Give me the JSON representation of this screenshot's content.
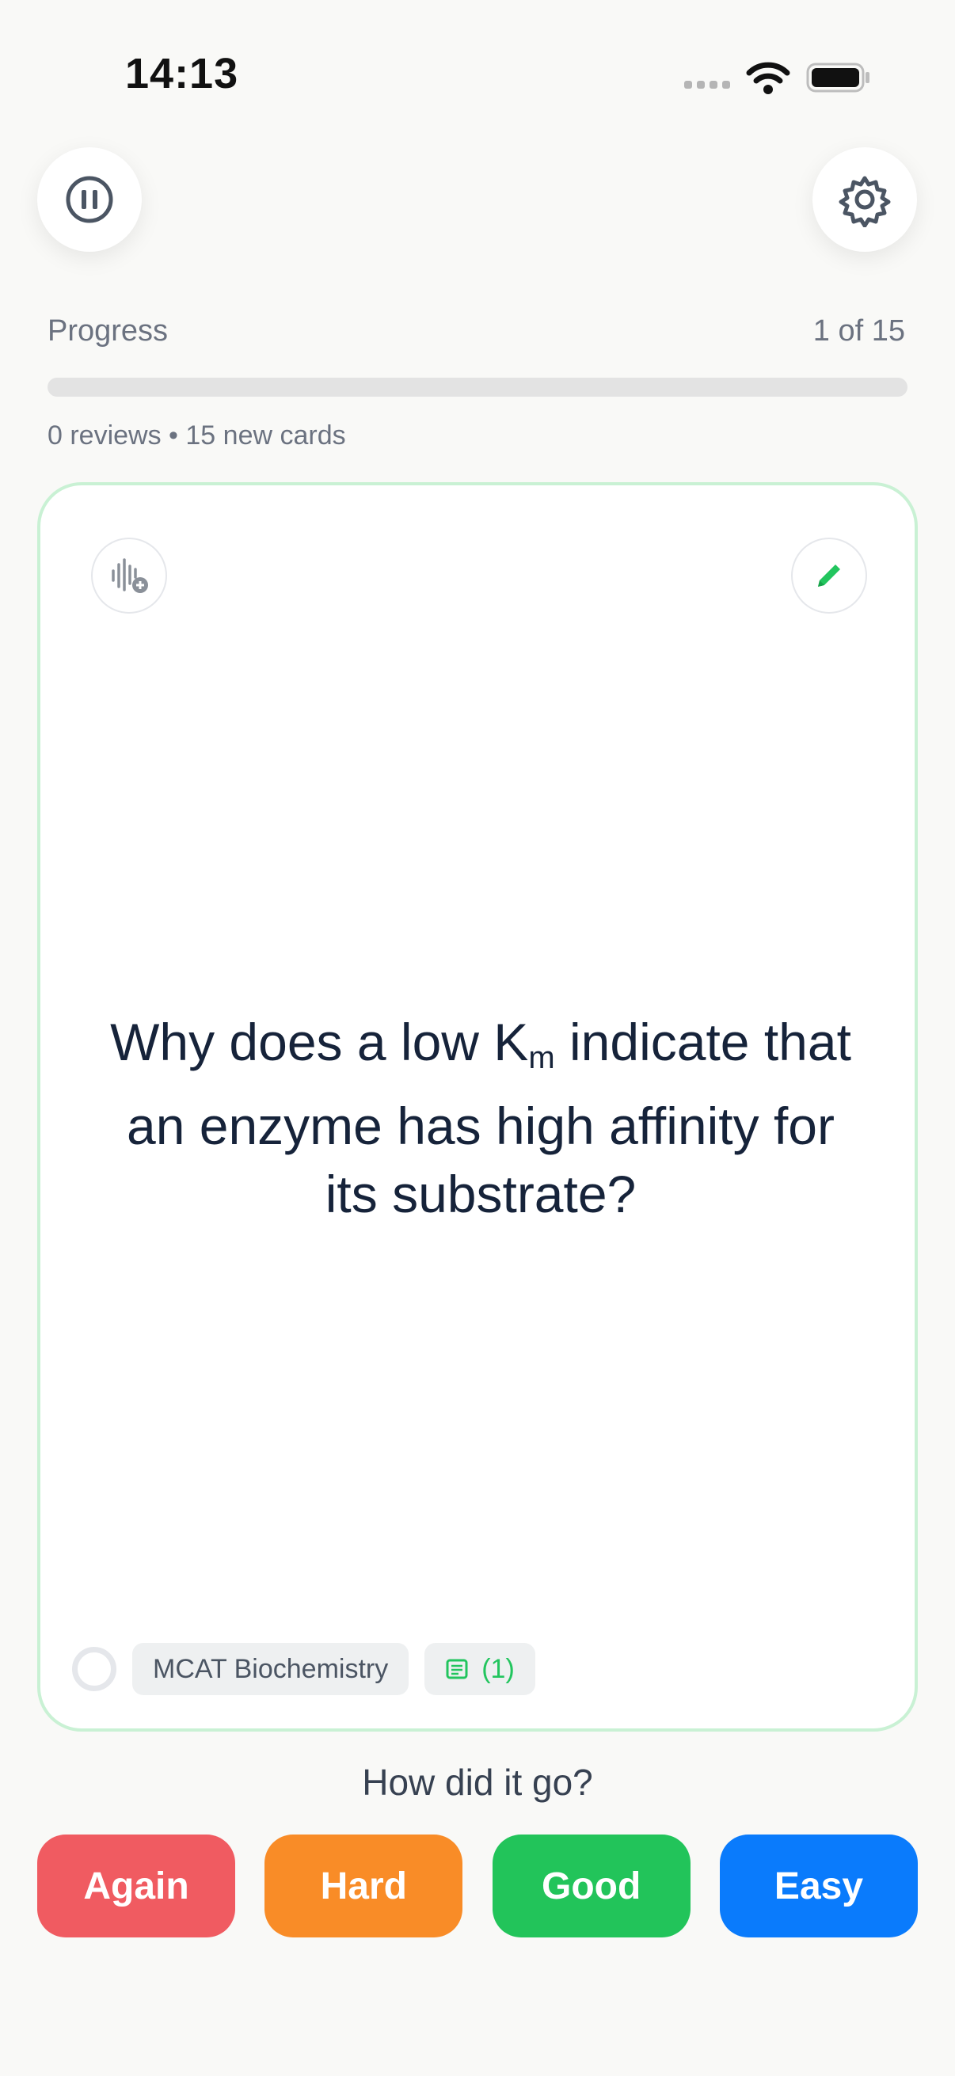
{
  "status_bar": {
    "time": "14:13"
  },
  "header": {
    "pause_icon": "pause-icon",
    "settings_icon": "gear-icon"
  },
  "progress": {
    "label": "Progress",
    "count": "1 of 15",
    "fraction": 0,
    "summary": "0 reviews • 15 new cards"
  },
  "card": {
    "audio_icon": "audio-waveform-add-icon",
    "edit_icon": "pencil-icon",
    "question_prefix": "Why does a low K",
    "question_sub": "m",
    "question_suffix": " indicate that an enzyme has high affinity for its substrate?",
    "deck_name": "MCAT Biochemistry",
    "notes_count": "(1)",
    "notes_icon": "note-icon"
  },
  "rating": {
    "prompt": "How did it go?",
    "buttons": [
      {
        "label": "Again",
        "color": "#f05b61"
      },
      {
        "label": "Hard",
        "color": "#f98c27"
      },
      {
        "label": "Good",
        "color": "#22c45a"
      },
      {
        "label": "Easy",
        "color": "#0a7bfc"
      }
    ]
  },
  "colors": {
    "accent": "#22c55e",
    "card_border": "#c9f1d4",
    "background": "#f9f9f7"
  }
}
